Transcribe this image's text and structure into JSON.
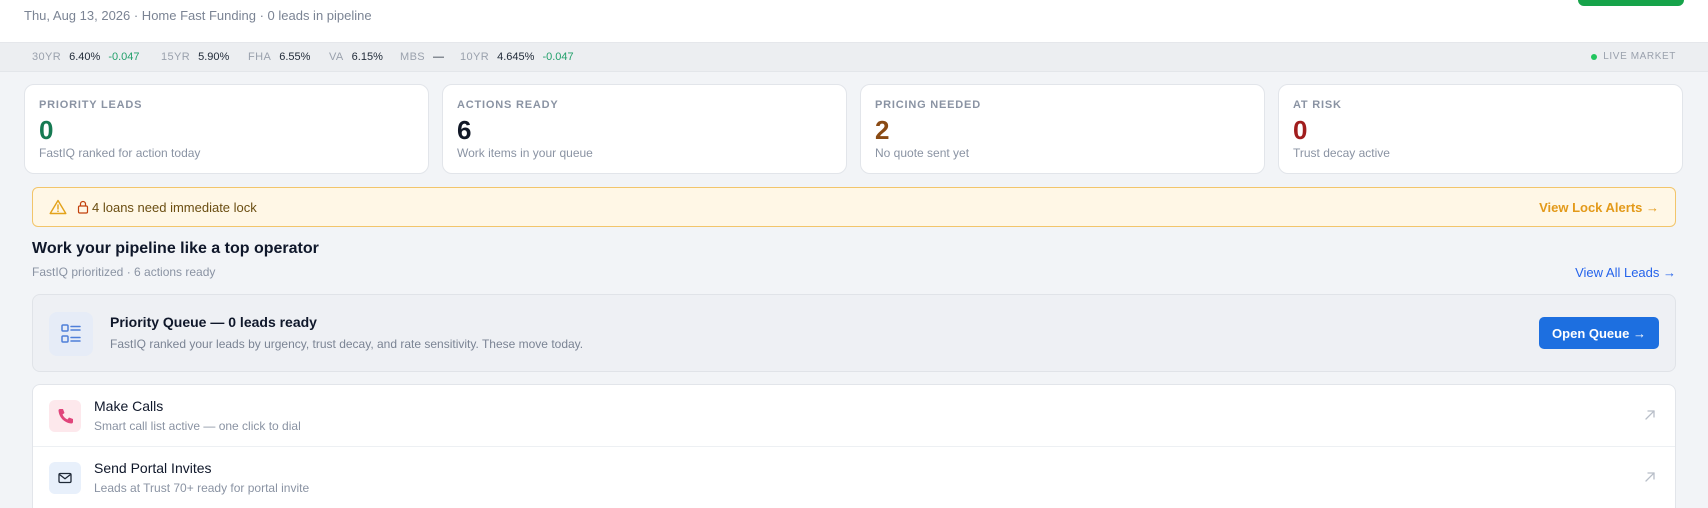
{
  "header": {
    "subtitle": "Thu, Aug 13, 2026 · Home Fast Funding · 0 leads in pipeline"
  },
  "ticker": {
    "items": [
      {
        "label": "30YR",
        "value": "6.40%",
        "change": "-0.047"
      },
      {
        "label": "15YR",
        "value": "5.90%",
        "change": ""
      },
      {
        "label": "FHA",
        "value": "6.55%",
        "change": ""
      },
      {
        "label": "VA",
        "value": "6.15%",
        "change": ""
      },
      {
        "label": "MBS",
        "value": "—",
        "change": ""
      },
      {
        "label": "10YR",
        "value": "4.645%",
        "change": "-0.047"
      }
    ],
    "live_label": "LIVE MARKET"
  },
  "metrics": [
    {
      "label": "PRIORITY LEADS",
      "value": "0",
      "sub": "FastIQ ranked for action today",
      "color": "#167a52"
    },
    {
      "label": "ACTIONS READY",
      "value": "6",
      "sub": "Work items in your queue",
      "color": "#111827"
    },
    {
      "label": "PRICING NEEDED",
      "value": "2",
      "sub": "No quote sent yet",
      "color": "#8a4a14"
    },
    {
      "label": "AT RISK",
      "value": "0",
      "sub": "Trust decay active",
      "color": "#a11d1d"
    }
  ],
  "alert": {
    "text": "4 loans need immediate lock",
    "link": "View Lock Alerts →"
  },
  "section": {
    "title": "Work your pipeline like a top operator",
    "subtitle": "FastIQ prioritized · 6 actions ready",
    "view_all": "View All Leads →"
  },
  "priority_queue": {
    "title": "Priority Queue — 0 leads ready",
    "subtitle": "FastIQ ranked your leads by urgency, trust decay, and rate sensitivity. These move today.",
    "button": "Open Queue →"
  },
  "actions": [
    {
      "title": "Make Calls",
      "subtitle": "Smart call list active — one click to dial",
      "icon": "phone-icon"
    },
    {
      "title": "Send Portal Invites",
      "subtitle": "Leads at Trust 70+ ready for portal invite",
      "icon": "mail-icon"
    }
  ]
}
